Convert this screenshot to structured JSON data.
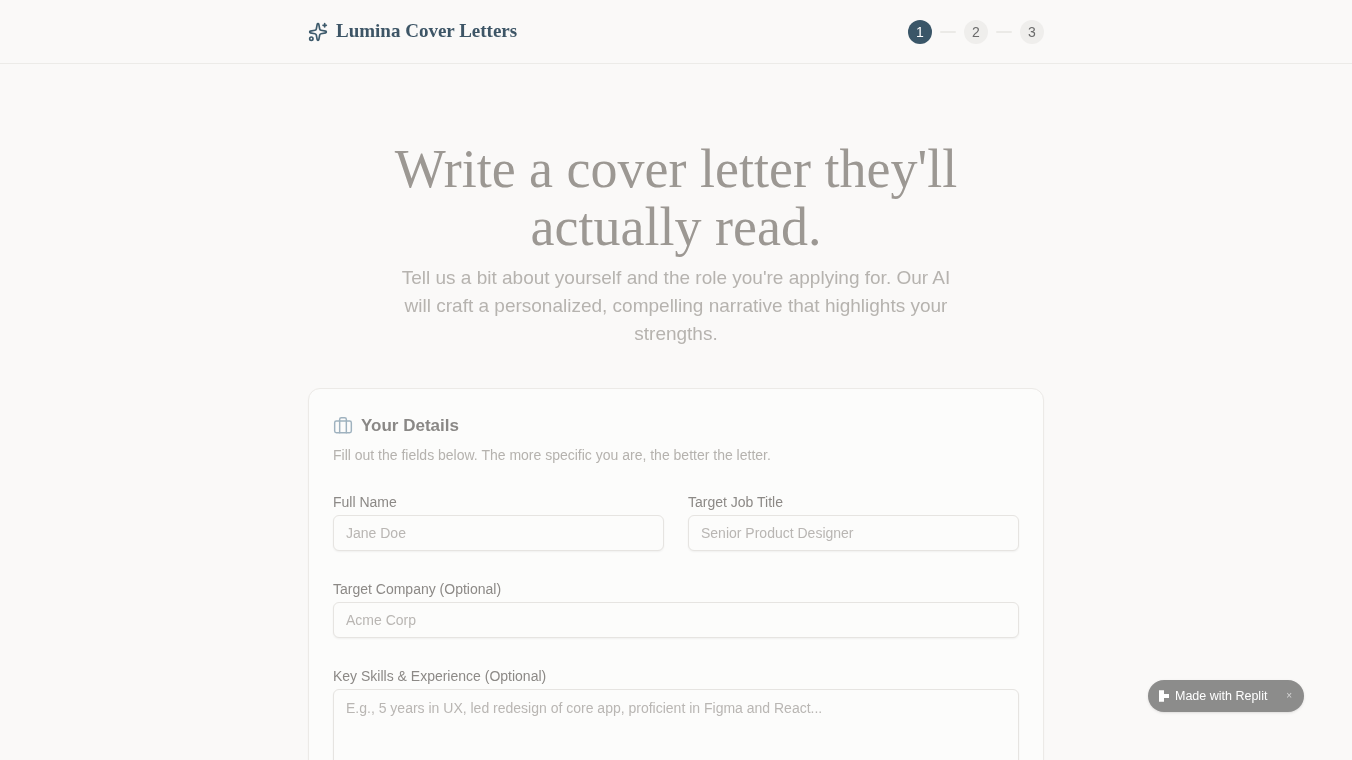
{
  "header": {
    "brand": "Lumina Cover Letters",
    "steps": [
      {
        "label": "1",
        "selected": true
      },
      {
        "label": "2",
        "selected": false
      },
      {
        "label": "3",
        "selected": false
      }
    ]
  },
  "hero": {
    "title": "Write a cover letter they'll actually read.",
    "subtitle": "Tell us a bit about yourself and the role you're applying for. Our AI will craft a personalized, compelling narrative that highlights your strengths."
  },
  "form": {
    "title": "Your Details",
    "description": "Fill out the fields below. The more specific you are, the better the letter.",
    "rows": [
      [
        {
          "kind": "input",
          "label": "Full Name",
          "placeholder": "Jane Doe"
        },
        {
          "kind": "input",
          "label": "Target Job Title",
          "placeholder": "Senior Product Designer"
        }
      ],
      [
        {
          "kind": "input",
          "label": "Target Company (Optional)",
          "placeholder": "Acme Corp"
        }
      ],
      [
        {
          "kind": "textarea",
          "label": "Key Skills & Experience (Optional)",
          "placeholder": "E.g., 5 years in UX, led redesign of core app, proficient in Figma and React..."
        }
      ]
    ]
  },
  "badge": {
    "label": "Made with Replit",
    "close": "×"
  }
}
